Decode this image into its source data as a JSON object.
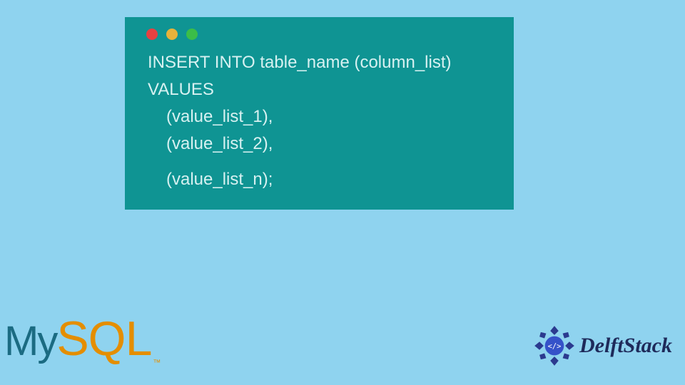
{
  "code": {
    "line1": "INSERT INTO table_name (column_list)",
    "line2": "VALUES",
    "line3": "(value_list_1),",
    "line4": "(value_list_2),",
    "line5": "(value_list_n);"
  },
  "logos": {
    "mysql_my": "My",
    "mysql_sql": "SQL",
    "mysql_tm": "™",
    "delft_text": "DelftStack"
  }
}
